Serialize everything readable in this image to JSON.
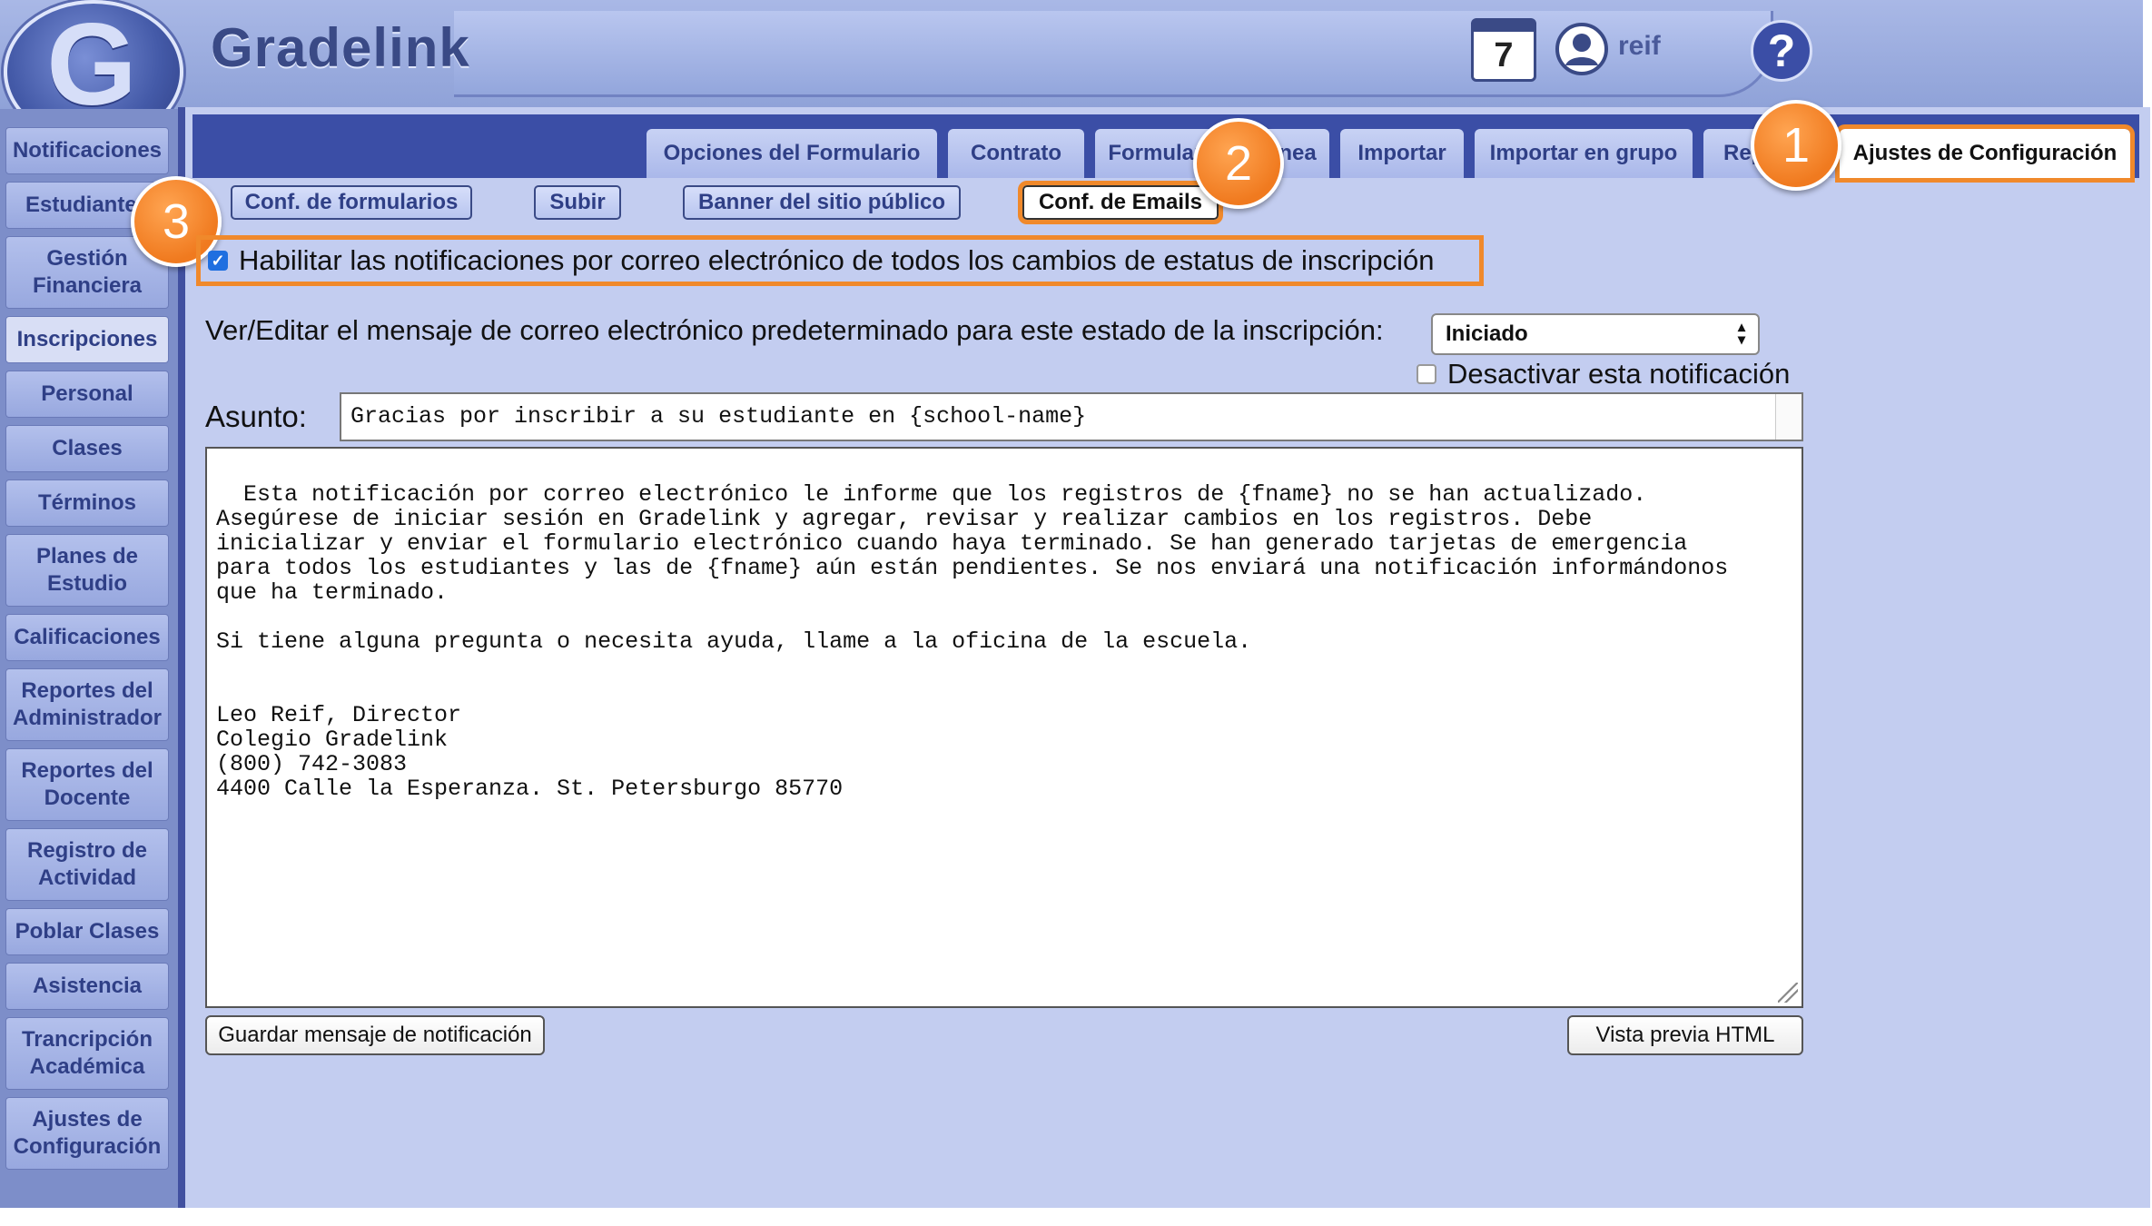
{
  "header": {
    "app_title": "Gradelink",
    "logo_letter": "G",
    "calendar_day": "7",
    "user_name": "reif",
    "help_label": "?"
  },
  "sidebar": {
    "items": [
      {
        "label": "Notificaciones"
      },
      {
        "label": "Estudiantes"
      },
      {
        "label": "Gestión Financiera"
      },
      {
        "label": "Inscripciones"
      },
      {
        "label": "Personal"
      },
      {
        "label": "Clases"
      },
      {
        "label": "Términos"
      },
      {
        "label": "Planes de Estudio"
      },
      {
        "label": "Calificaciones"
      },
      {
        "label": "Reportes del Administrador"
      },
      {
        "label": "Reportes del Docente"
      },
      {
        "label": "Registro de Actividad"
      },
      {
        "label": "Poblar Clases"
      },
      {
        "label": "Asistencia"
      },
      {
        "label": "Trancripción Académica"
      },
      {
        "label": "Ajustes de Configuración"
      }
    ],
    "active": "Inscripciones"
  },
  "tabs": [
    {
      "label": "Opciones del Formulario"
    },
    {
      "label": "Contrato"
    },
    {
      "label": "Formulario en Línea"
    },
    {
      "label": "Importar"
    },
    {
      "label": "Importar en grupo"
    },
    {
      "label": "Reportes"
    },
    {
      "label": "Ajustes de Configuración"
    }
  ],
  "subtabs": [
    {
      "label": "Conf. de formularios"
    },
    {
      "label": "Subir"
    },
    {
      "label": "Banner del sitio público"
    },
    {
      "label": "Conf. de Emails"
    }
  ],
  "badges": [
    "1",
    "2",
    "3"
  ],
  "form": {
    "enable_label": "Habilitar las notificaciones por correo electrónico de todos los cambios de estatus de inscripción",
    "enable_checked": true,
    "prompt_label": "Ver/Editar el mensaje de correo electrónico predeterminado para este estado de la inscripción:",
    "status_selected": "Iniciado",
    "disable_label": "Desactivar esta notificación",
    "subject_label": "Asunto:",
    "subject_value": "Gracias por inscribir a su estudiante en {school-name}",
    "body_value": "Esta notificación por correo electrónico le informe que los registros de {fname} no se han actualizado.\nAsegúrese de iniciar sesión en Gradelink y agregar, revisar y realizar cambios en los registros. Debe\ninicializar y enviar el formulario electrónico cuando haya terminado. Se han generado tarjetas de emergencia\npara todos los estudiantes y las de {fname} aún están pendientes. Se nos enviará una notificación informándonos\nque ha terminado.\n\nSi tiene alguna pregunta o necesita ayuda, llame a la oficina de la escuela.\n\n\nLeo Reif, Director\nColegio Gradelink\n(800) 742-3083\n4400 Calle la Esperanza. St. Petersburgo 85770",
    "save_button": "Guardar mensaje de notificación",
    "preview_button": "Vista previa HTML"
  },
  "colors": {
    "accent_orange": "#f0892b",
    "tab_bar_blue": "#3b4ea6",
    "panel_bg": "#c3cdf0"
  }
}
